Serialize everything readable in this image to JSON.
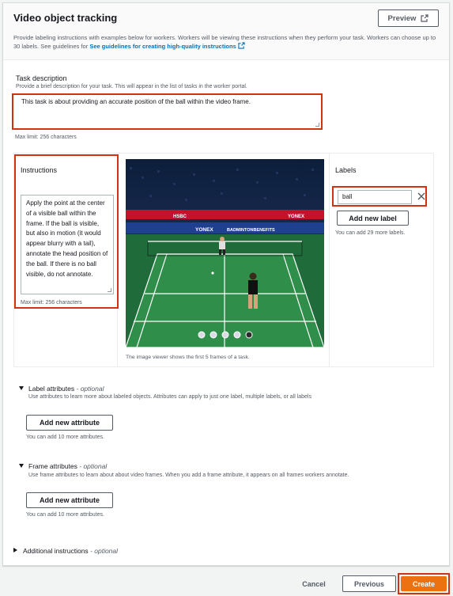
{
  "header": {
    "title": "Video object tracking",
    "preview_label": "Preview",
    "description": "Provide labeling instructions with examples below for workers. Workers will be viewing these instructions when they perform your task. Workers can choose up to 30 labels. See guidelines for",
    "guidelines_link": "See guidelines for creating high-quality instructions"
  },
  "task": {
    "label": "Task description",
    "hint": "Provide a brief description for your task. This will appear in the list of tasks in the worker portal.",
    "value": "This task is about providing an accurate position of the ball within the video frame.",
    "max_limit": "Max limit: 256 characters"
  },
  "instructions": {
    "label": "Instructions",
    "text": "Apply the point at the center of a visible ball within the frame. If the ball is visible, but also in motion (it would appear blurry with a tail), annotate the head position of the ball. If there is no ball visible, do not annotate.",
    "max_limit": "Max limit: 256 characters"
  },
  "viewer": {
    "caption": "The image viewer shows the first 5 frames of a task.",
    "banner_text_1": "YONEX",
    "banner_text_2": "BADMINTONBENEFITS",
    "banner_text_3": "HSBC",
    "banner_text_4": "YONEX",
    "frame_count": 5,
    "active_frame": 5
  },
  "labels": {
    "label": "Labels",
    "items": [
      "ball"
    ],
    "add_label": "Add new label",
    "remaining": "You can add 29 more labels."
  },
  "label_attributes": {
    "title": "Label attributes",
    "optional": "- optional",
    "desc": "Use attributes to learn more about labeled objects. Attributes can apply to just one label, multiple labels, or all labels",
    "button": "Add new attribute",
    "remaining": "You can add 10 more attributes."
  },
  "frame_attributes": {
    "title": "Frame attributes",
    "optional": "- optional",
    "desc": "Use frame attributes to learn about about video frames. When you add a frame attribute, it appears on all frames workers annotate.",
    "button": "Add new attribute",
    "remaining": "You can add 10 more attributes."
  },
  "additional": {
    "title": "Additional instructions",
    "optional": "- optional"
  },
  "footer": {
    "cancel": "Cancel",
    "previous": "Previous",
    "create": "Create"
  },
  "colors": {
    "accent": "#ec7211",
    "error": "#d13212",
    "link": "#0073bb"
  }
}
